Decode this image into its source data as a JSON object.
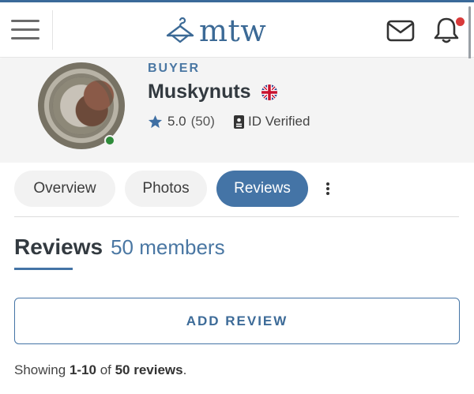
{
  "header": {
    "logo_text": "mtw",
    "menu_icon": "hamburger-menu-icon",
    "mail_icon": "envelope-icon",
    "bell_icon": "bell-icon"
  },
  "profile": {
    "role": "BUYER",
    "username": "Muskynuts",
    "country_flag": "uk-flag-icon",
    "rating_score": "5.0",
    "rating_count": "(50)",
    "verified_label": "ID Verified",
    "online": true
  },
  "tabs": {
    "overview": "Overview",
    "photos": "Photos",
    "reviews": "Reviews",
    "active": "reviews"
  },
  "section": {
    "title": "Reviews",
    "subtitle": "50 members"
  },
  "actions": {
    "add_review": "ADD REVIEW"
  },
  "pagination": {
    "prefix": "Showing ",
    "range": "1-10",
    "middle": " of ",
    "total": "50 reviews",
    "suffix": "."
  },
  "colors": {
    "brand": "#3c6a96",
    "accent": "#4474a6",
    "notification": "#d93a3a",
    "online": "#2e8b3a"
  }
}
